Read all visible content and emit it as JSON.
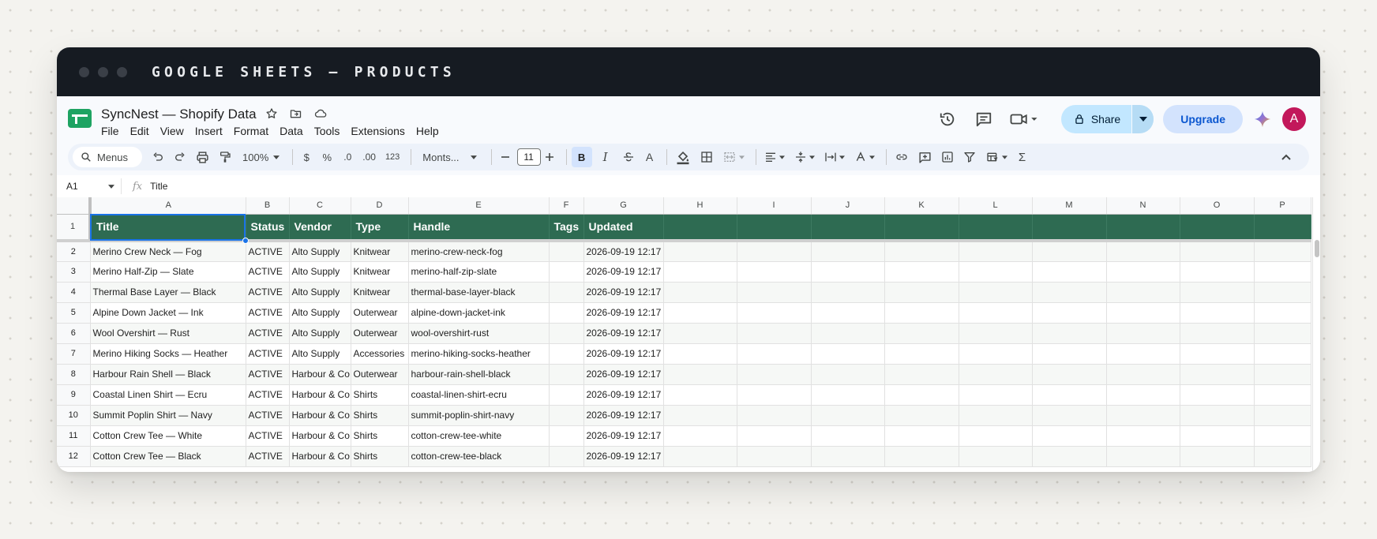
{
  "window": {
    "title": "GOOGLE SHEETS — PRODUCTS"
  },
  "doc": {
    "name": "SyncNest — Shopify Data"
  },
  "menu": [
    "File",
    "Edit",
    "View",
    "Insert",
    "Format",
    "Data",
    "Tools",
    "Extensions",
    "Help"
  ],
  "header": {
    "share_label": "Share",
    "upgrade_label": "Upgrade",
    "avatar_letter": "A"
  },
  "toolbar": {
    "search_label": "Menus",
    "zoom": "100%",
    "currency": "$",
    "percent": "%",
    "decrease_decimal": ".0",
    "increase_decimal": ".00",
    "number_format": "123",
    "font": "Monts...",
    "font_size": "11",
    "bold": "B",
    "italic": "I",
    "text_color": "A",
    "sum": "Σ"
  },
  "formula_bar": {
    "cell_ref": "A1",
    "fx": "fx",
    "content": "Title"
  },
  "columns": [
    "A",
    "B",
    "C",
    "D",
    "E",
    "F",
    "G",
    "H",
    "I",
    "J",
    "K",
    "L",
    "M",
    "N",
    "O",
    "P"
  ],
  "header_row": {
    "row_number": "1",
    "cells": [
      "Title",
      "Status",
      "Vendor",
      "Type",
      "Handle",
      "Tags",
      "Updated"
    ]
  },
  "rows": [
    {
      "n": "2",
      "cells": [
        "Merino Crew Neck — Fog",
        "ACTIVE",
        "Alto Supply",
        "Knitwear",
        "merino-crew-neck-fog",
        "",
        "2026-09-19 12:17"
      ]
    },
    {
      "n": "3",
      "cells": [
        "Merino Half-Zip — Slate",
        "ACTIVE",
        "Alto Supply",
        "Knitwear",
        "merino-half-zip-slate",
        "",
        "2026-09-19 12:17"
      ]
    },
    {
      "n": "4",
      "cells": [
        "Thermal Base Layer — Black",
        "ACTIVE",
        "Alto Supply",
        "Knitwear",
        "thermal-base-layer-black",
        "",
        "2026-09-19 12:17"
      ]
    },
    {
      "n": "5",
      "cells": [
        "Alpine Down Jacket — Ink",
        "ACTIVE",
        "Alto Supply",
        "Outerwear",
        "alpine-down-jacket-ink",
        "",
        "2026-09-19 12:17"
      ]
    },
    {
      "n": "6",
      "cells": [
        "Wool Overshirt — Rust",
        "ACTIVE",
        "Alto Supply",
        "Outerwear",
        "wool-overshirt-rust",
        "",
        "2026-09-19 12:17"
      ]
    },
    {
      "n": "7",
      "cells": [
        "Merino Hiking Socks — Heather",
        "ACTIVE",
        "Alto Supply",
        "Accessories",
        "merino-hiking-socks-heather",
        "",
        "2026-09-19 12:17"
      ]
    },
    {
      "n": "8",
      "cells": [
        "Harbour Rain Shell — Black",
        "ACTIVE",
        "Harbour & Co",
        "Outerwear",
        "harbour-rain-shell-black",
        "",
        "2026-09-19 12:17"
      ]
    },
    {
      "n": "9",
      "cells": [
        "Coastal Linen Shirt — Ecru",
        "ACTIVE",
        "Harbour & Co",
        "Shirts",
        "coastal-linen-shirt-ecru",
        "",
        "2026-09-19 12:17"
      ]
    },
    {
      "n": "10",
      "cells": [
        "Summit Poplin Shirt — Navy",
        "ACTIVE",
        "Harbour & Co",
        "Shirts",
        "summit-poplin-shirt-navy",
        "",
        "2026-09-19 12:17"
      ]
    },
    {
      "n": "11",
      "cells": [
        "Cotton Crew Tee — White",
        "ACTIVE",
        "Harbour & Co",
        "Shirts",
        "cotton-crew-tee-white",
        "",
        "2026-09-19 12:17"
      ]
    },
    {
      "n": "12",
      "cells": [
        "Cotton Crew Tee — Black",
        "ACTIVE",
        "Harbour & Co",
        "Shirts",
        "cotton-crew-tee-black",
        "",
        "2026-09-19 12:17"
      ]
    }
  ],
  "colors": {
    "header_fill": "#2e6b52",
    "selection": "#1a73e8",
    "share_bg": "#c2e7ff",
    "avatar": "#c2185b",
    "titlebar": "#161b22"
  }
}
